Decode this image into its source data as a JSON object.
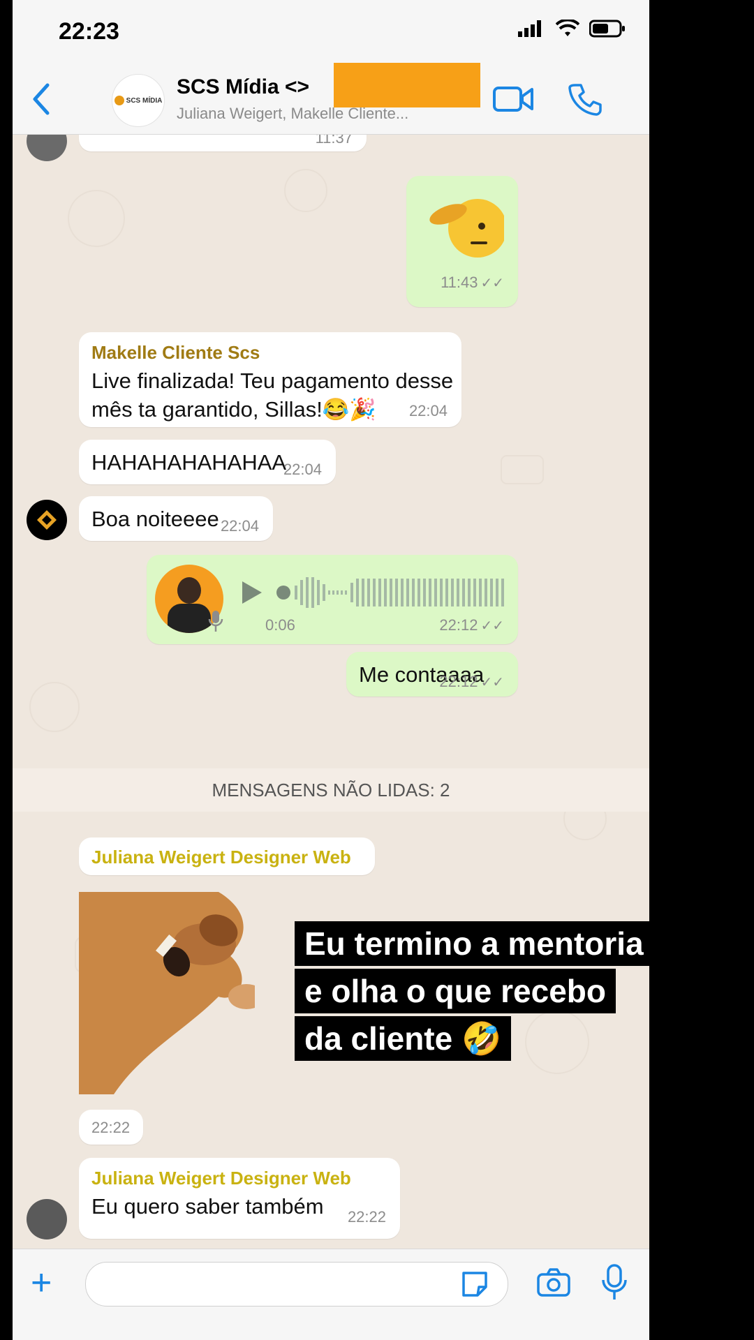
{
  "status": {
    "time": "22:23"
  },
  "header": {
    "title": "SCS Mídia <>",
    "subtitle": "Juliana Weigert, Makelle Cliente...",
    "avatar_text": "SCS MÍDIA"
  },
  "messages": {
    "top_partial_time": "11:37",
    "salute_time": "11:43",
    "makelle": {
      "sender": "Makelle Cliente Scs",
      "line1": "Live finalizada! Teu pagamento desse",
      "line2": "mês ta garantido, Sillas!😂🎉",
      "time": "22:04"
    },
    "haha": {
      "text": "HAHAHAHAHAHAA",
      "time": "22:04"
    },
    "boa": {
      "text": "Boa noiteeee",
      "time": "22:04"
    },
    "voice": {
      "duration": "0:06",
      "time": "22:12"
    },
    "conta": {
      "text": "Me contaaaa",
      "time": "22:12"
    },
    "unread": "MENSAGENS NÃO LIDAS: 2",
    "juliana_sticker": {
      "sender": "Juliana Weigert Designer Web",
      "time": "22:22"
    },
    "juliana_text": {
      "sender": "Juliana Weigert Designer Web",
      "text": "Eu quero saber também",
      "time": "22:22"
    }
  },
  "caption": {
    "line1": "Eu termino a mentoria",
    "line2": "e olha o que recebo",
    "line3": "da cliente 🤣"
  },
  "colors": {
    "accent": "#1b86e3",
    "outgoing": "#dcf8c6",
    "redaction": "#f7a017"
  }
}
